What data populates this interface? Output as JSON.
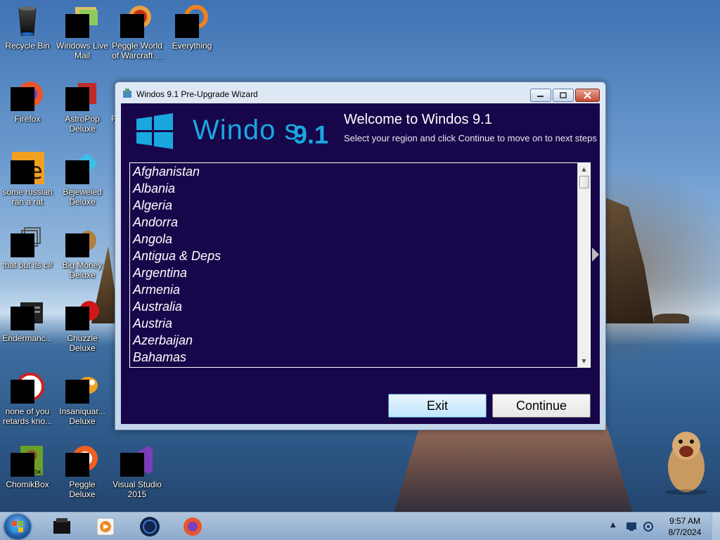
{
  "desktop": {
    "icons": [
      {
        "label": "Recycle Bin",
        "name": "recycle-bin-icon"
      },
      {
        "label": "Windows Live Mail",
        "name": "windows-live-mail-icon"
      },
      {
        "label": "Peggle World of Warcraft ...",
        "name": "peggle-wow-icon"
      },
      {
        "label": "Everything",
        "name": "everything-icon"
      },
      {
        "label": "Firefox",
        "name": "firefox-icon"
      },
      {
        "label": "AstroPop Deluxe",
        "name": "astropop-icon"
      },
      {
        "label": "some russian ran a rat",
        "name": "russian-rat-icon"
      },
      {
        "label": "Bejeweled Deluxe",
        "name": "bejeweled-icon"
      },
      {
        "label": "that but its c#",
        "name": "csharp-icon"
      },
      {
        "label": "Big Money Deluxe",
        "name": "big-money-icon"
      },
      {
        "label": "Endermanc...",
        "name": "endermanc-icon"
      },
      {
        "label": "Chuzzle Deluxe",
        "name": "chuzzle-icon"
      },
      {
        "label": "none of you retards kno...",
        "name": "none-of-you-icon"
      },
      {
        "label": "Insaniquar... Deluxe",
        "name": "insaniquarium-icon"
      },
      {
        "label": "ChomikBox",
        "name": "chomikbox-icon"
      },
      {
        "label": "Peggle Deluxe",
        "name": "peggle-deluxe-icon"
      },
      {
        "label": "Visual Studio 2015",
        "name": "visual-studio-icon"
      }
    ],
    "partial_label": "F"
  },
  "window": {
    "title": "Windos 9.1 Pre-Upgrade Wizard",
    "logo_word": "Windo  s",
    "logo_version": "9.1",
    "welcome": "Welcome to Windos 9.1",
    "subtitle": "Select your region and click Continue to move on to next steps",
    "countries": [
      "Afghanistan",
      "Albania",
      "Algeria",
      "Andorra",
      "Angola",
      "Antigua & Deps",
      "Argentina",
      "Armenia",
      "Australia",
      "Austria",
      "Azerbaijan",
      "Bahamas"
    ],
    "exit_label": "Exit",
    "continue_label": "Continue"
  },
  "taskbar": {
    "time": "9:57 AM",
    "date": "8/7/2024"
  },
  "colors": {
    "client_bg": "#18064a",
    "logo_blue": "#19a7e0"
  }
}
